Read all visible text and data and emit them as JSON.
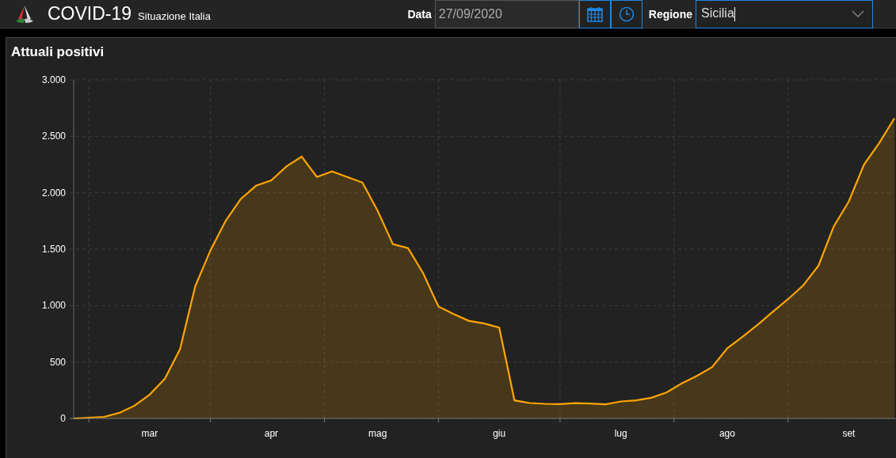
{
  "header": {
    "title": "COVID-19",
    "subtitle": "Situazione Italia"
  },
  "filters": {
    "date_label": "Data",
    "date_value": "27/09/2020",
    "region_label": "Regione",
    "region_value": "Sicilia"
  },
  "panel": {
    "title": "Attuali positivi",
    "chart_data": {
      "type": "area",
      "grid": true,
      "ylim": [
        0,
        3000
      ],
      "yticks": [
        {
          "value": 0,
          "label": "0"
        },
        {
          "value": 500,
          "label": "500"
        },
        {
          "value": 1000,
          "label": "1.000"
        },
        {
          "value": 1500,
          "label": "1.500"
        },
        {
          "value": 2000,
          "label": "2.000"
        },
        {
          "value": 2500,
          "label": "2.500"
        },
        {
          "value": 3000,
          "label": "3.000"
        }
      ],
      "categories": [
        null,
        null,
        null,
        null,
        null,
        "mar",
        null,
        null,
        null,
        null,
        null,
        null,
        null,
        "apr",
        null,
        null,
        null,
        null,
        null,
        null,
        "mag",
        null,
        null,
        null,
        null,
        null,
        null,
        null,
        "giu",
        null,
        null,
        null,
        null,
        null,
        null,
        null,
        "lug",
        null,
        null,
        null,
        null,
        null,
        null,
        "ago",
        null,
        null,
        null,
        null,
        null,
        null,
        null,
        "set",
        null,
        null,
        null
      ],
      "series": [
        {
          "color": "#ffa500",
          "values": [
            0,
            7,
            14,
            50,
            113,
            212,
            352,
            615,
            1173,
            1490,
            1752,
            1945,
            2062,
            2110,
            2233,
            2320,
            2140,
            2190,
            2140,
            2090,
            1840,
            1545,
            1510,
            1285,
            992,
            925,
            865,
            842,
            805,
            160,
            137,
            130,
            127,
            136,
            132,
            125,
            151,
            160,
            183,
            230,
            310,
            377,
            455,
            622,
            723,
            830,
            945,
            1057,
            1180,
            1353,
            1700,
            1923,
            2250,
            2440,
            2660
          ]
        }
      ]
    }
  }
}
